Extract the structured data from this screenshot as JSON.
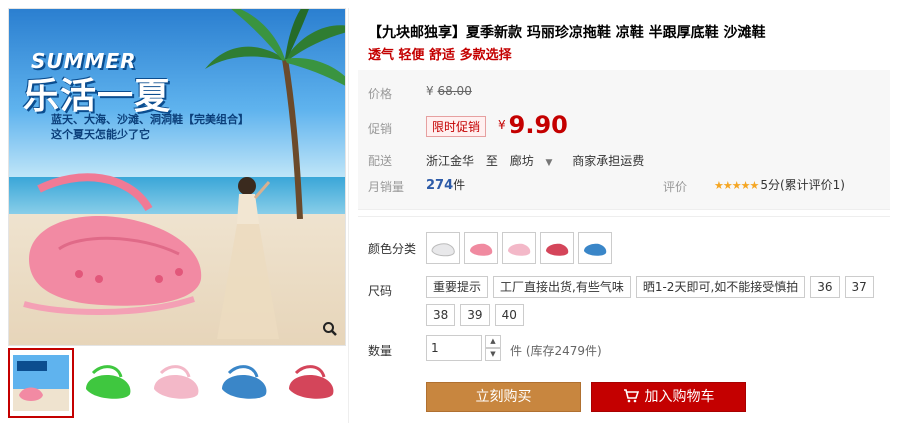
{
  "product": {
    "title": "【九块邮独享】夏季新款 玛丽珍凉拖鞋 凉鞋 半跟厚底鞋 沙滩鞋",
    "subtitle": "透气 轻便 舒适 多款选择"
  },
  "banner": {
    "word": "SUMMER",
    "title": "乐活一夏",
    "sub_line1": "蓝天、大海、沙滩、洞洞鞋【完美组合】",
    "sub_line2": "这个夏天怎能少了它"
  },
  "price": {
    "label": "价格",
    "currency": "¥",
    "original": "68.00"
  },
  "promo": {
    "label": "促销",
    "badge": "限时促销",
    "currency": "¥",
    "price": "9.90"
  },
  "shipping": {
    "label": "配送",
    "from": "浙江金华",
    "to_word": "至",
    "to": "廊坊",
    "chevron": "▼",
    "fee": "商家承担运费"
  },
  "sales": {
    "label": "月销量",
    "count": "274",
    "unit": "件"
  },
  "rating": {
    "label": "评价",
    "stars": "★★★★★",
    "text": "5分(累计评价1)"
  },
  "color": {
    "label": "颜色分类",
    "swatches": [
      "#e8e8ea",
      "#f08aa0",
      "#f3b8c8",
      "#d4455a",
      "#3a86c8"
    ]
  },
  "size": {
    "label": "尺码",
    "options": [
      "重要提示",
      "工厂直接出货,有些气味",
      "晒1-2天即可,如不能接受慎拍",
      "36",
      "37",
      "38",
      "39",
      "40"
    ]
  },
  "quantity": {
    "label": "数量",
    "value": "1",
    "unit_text": "件 (库存2479件)",
    "up": "▲",
    "down": "▼"
  },
  "actions": {
    "buy_now": "立刻购买",
    "add_to_cart": "加入购物车"
  },
  "thumbnails": {
    "colors": [
      "#f08aa0",
      "#3fc73f",
      "#f3b8c8",
      "#3a86c8",
      "#d4455a"
    ]
  }
}
